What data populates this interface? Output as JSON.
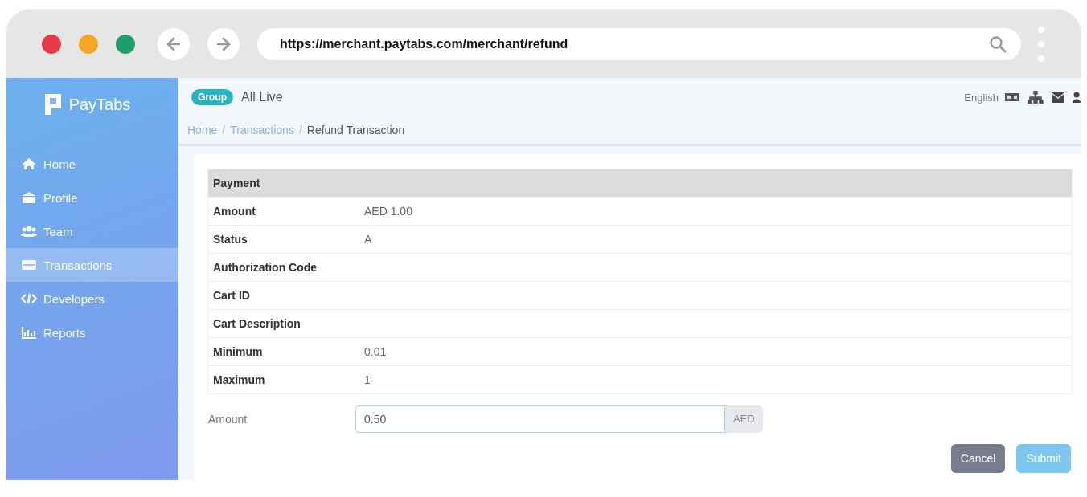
{
  "browser": {
    "url": "https://merchant.paytabs.com/merchant/refund"
  },
  "sidebar": {
    "logo": "PayTabs",
    "items": [
      {
        "label": "Home",
        "kind": "home",
        "selected": false
      },
      {
        "label": "Profile",
        "kind": "bank",
        "selected": false
      },
      {
        "label": "Team",
        "kind": "team",
        "selected": false
      },
      {
        "label": "Transactions",
        "kind": "card",
        "selected": true
      },
      {
        "label": "Developers",
        "kind": "code",
        "selected": false
      },
      {
        "label": "Reports",
        "kind": "chart",
        "selected": false
      }
    ]
  },
  "topbar": {
    "badge": "Group",
    "account": "All Live",
    "language": "English"
  },
  "breadcrumb_separator": "/",
  "breadcrumb": [
    {
      "label": "Home",
      "link": true
    },
    {
      "label": "Transactions",
      "link": true
    },
    {
      "label": "Refund Transaction",
      "link": false
    }
  ],
  "table": {
    "heading": "Payment",
    "rows": [
      {
        "label": "Amount",
        "value": "AED 1.00"
      },
      {
        "label": "Status",
        "value": "A"
      },
      {
        "label": "Authorization Code"
      },
      {
        "label": "Cart ID"
      },
      {
        "label": "Cart Description"
      },
      {
        "label": "Minimum",
        "value": "0.01"
      },
      {
        "label": "Maximum",
        "value": "1"
      }
    ]
  },
  "amount_field": {
    "label": "Amount",
    "value": "0.50",
    "suffix": "AED"
  },
  "buttons": [
    {
      "label": "Cancel",
      "kind": "cancel"
    },
    {
      "label": "Submit",
      "kind": "submit"
    }
  ]
}
